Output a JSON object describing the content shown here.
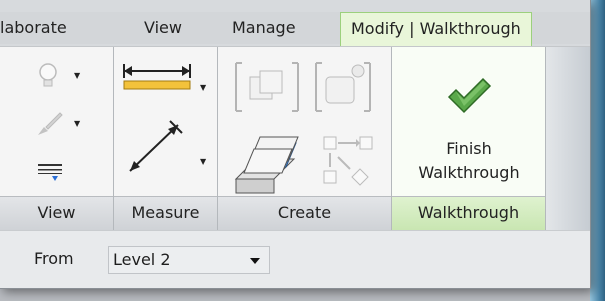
{
  "tabs": [
    "laborate",
    "View",
    "Manage",
    "Modify | Walkthrough"
  ],
  "panels": {
    "view": "View",
    "measure": "Measure",
    "create": "Create",
    "walkthrough": "Walkthrough"
  },
  "finish": {
    "line1": "Finish",
    "line2": "Walkthrough"
  },
  "options": {
    "from_label": "From",
    "level_value": "Level 2"
  },
  "colors": {
    "accent_green": "#4c9e3d",
    "active_tab_bg": "#e9f6d9"
  }
}
